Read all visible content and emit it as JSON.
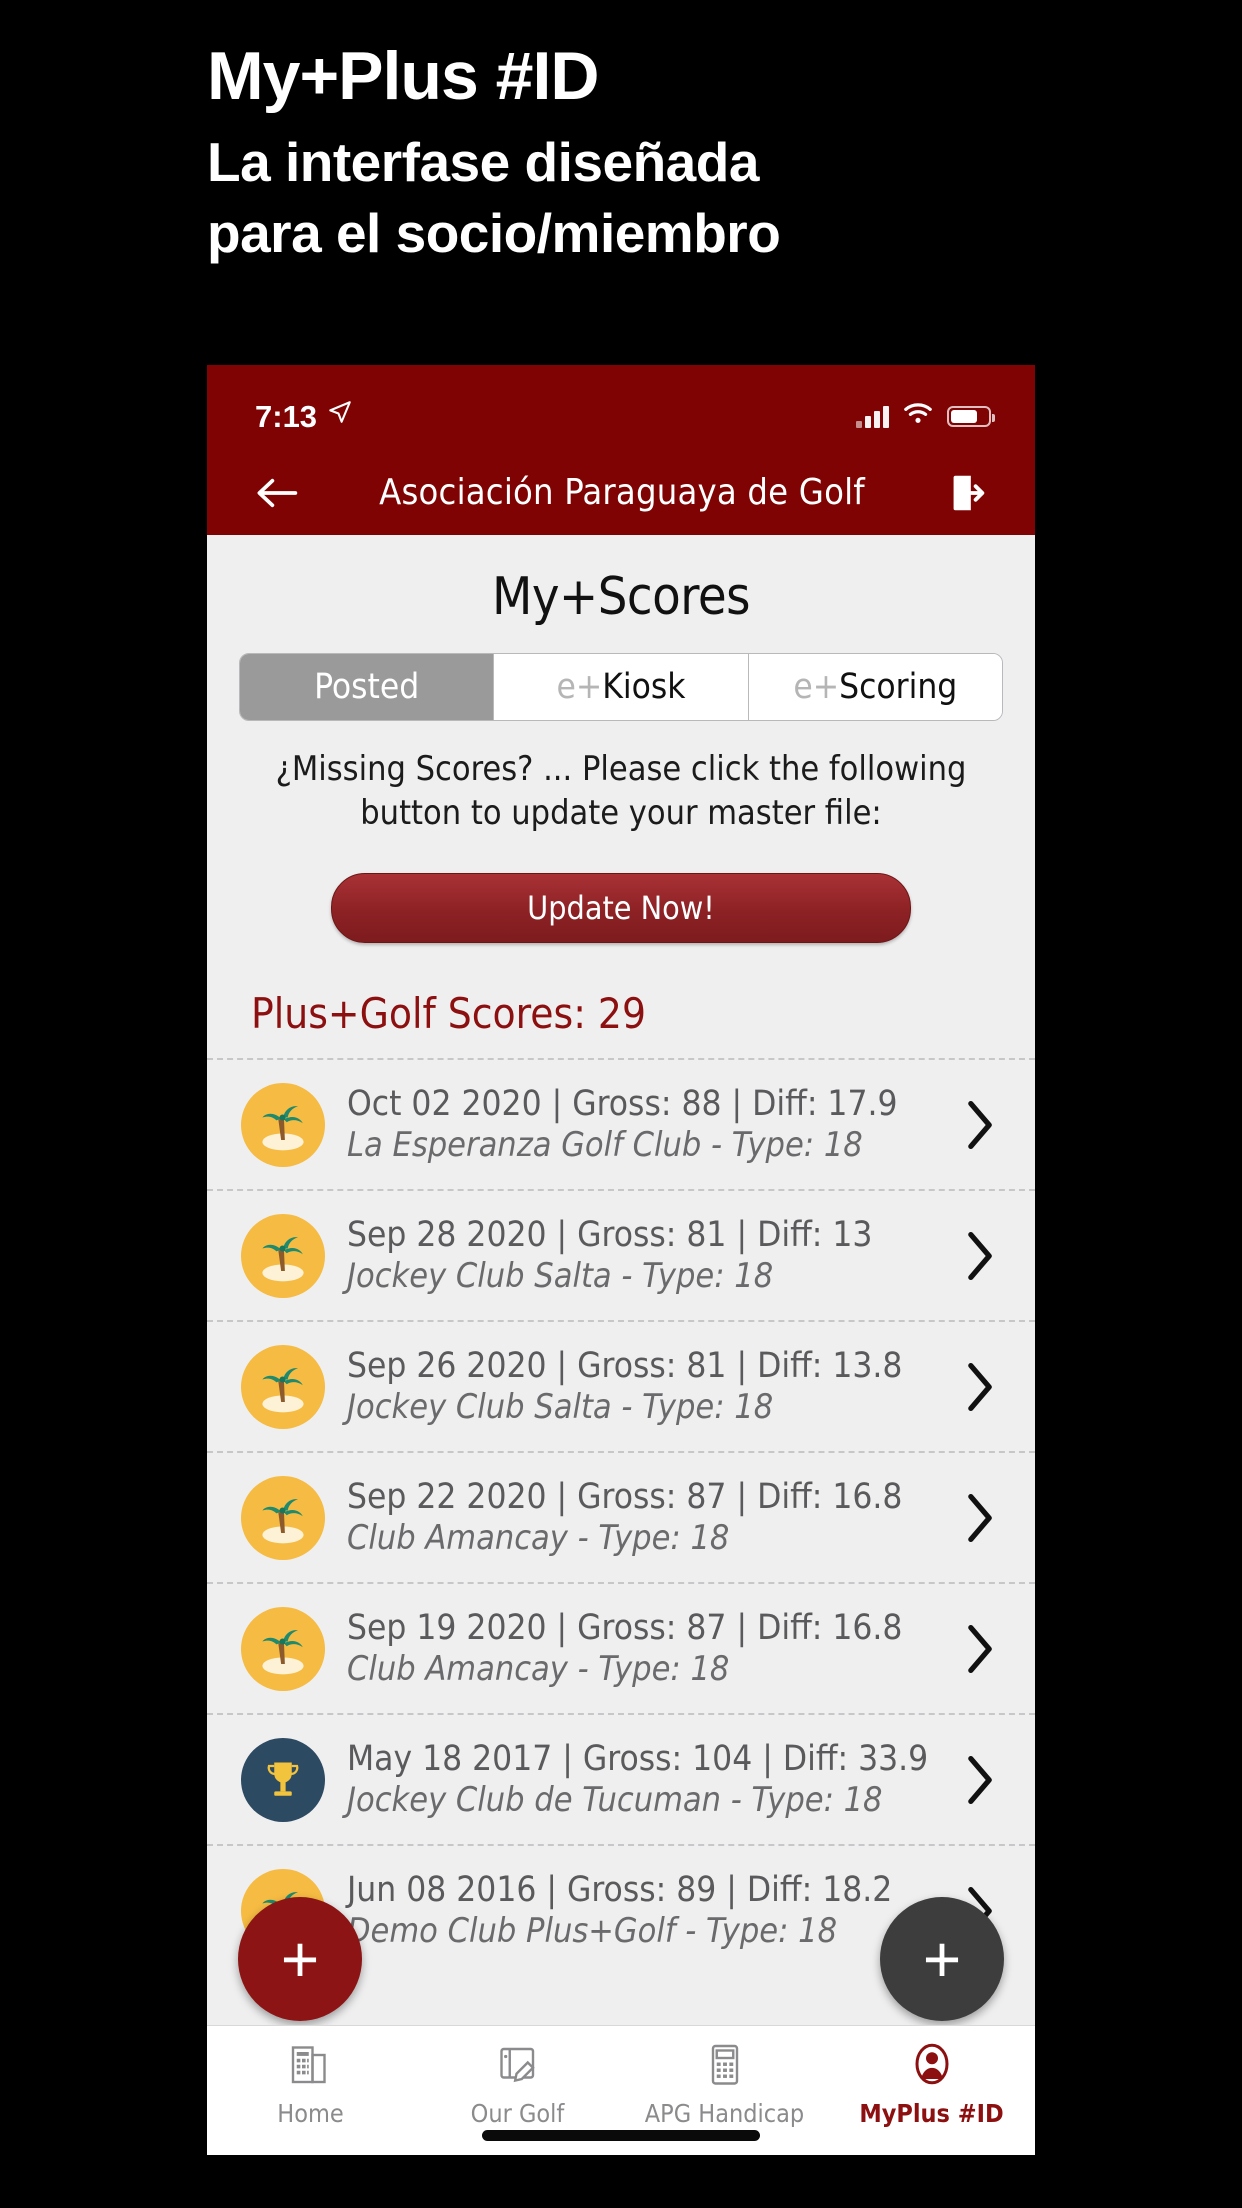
{
  "promo": {
    "title": "My+Plus #ID",
    "subtitle_line1": "La interfase diseñada",
    "subtitle_line2": "para el socio/miembro"
  },
  "colors": {
    "brand_red": "#800303",
    "accent_red": "#8d1010",
    "button_red": "#8e2225",
    "screen_bg": "#efeff0",
    "segment_active": "#9a9a9a",
    "palm_badge": "#f5bb42",
    "trophy_badge": "#2d4a63",
    "fab_left": "#8c1414",
    "fab_right": "#3d3d3d"
  },
  "statusbar": {
    "time": "7:13",
    "location_icon": "location-arrow-icon",
    "signal_icon": "cellular-signal-icon",
    "wifi_icon": "wifi-icon",
    "battery_icon": "battery-icon"
  },
  "navbar": {
    "back_icon": "back-arrow-icon",
    "title": "Asociación Paraguaya de Golf",
    "logout_icon": "logout-icon"
  },
  "screen": {
    "title": "My+Scores"
  },
  "segments": [
    {
      "prefix": "",
      "label": "Posted",
      "active": true
    },
    {
      "prefix": "e+",
      "label": "Kiosk",
      "active": false
    },
    {
      "prefix": "e+",
      "label": "Scoring",
      "active": false
    }
  ],
  "notice": {
    "text": "¿Missing Scores? ... Please click the following button to update your master file:"
  },
  "update_button": {
    "label": "Update Now!"
  },
  "scores_header": {
    "label": "Plus+Golf Scores: 29"
  },
  "scores": [
    {
      "icon": "palm-tree-icon",
      "icon_type": "palm",
      "line1": "Oct 02 2020 | Gross: 88 | Diff: 17.9",
      "line2": "La Esperanza Golf Club - Type: 18",
      "date": "Oct 02 2020",
      "gross": 88,
      "diff": 17.9,
      "club": "La Esperanza Golf Club",
      "type": 18
    },
    {
      "icon": "palm-tree-icon",
      "icon_type": "palm",
      "line1": "Sep 28 2020 | Gross: 81 | Diff: 13",
      "line2": "Jockey Club Salta - Type: 18",
      "date": "Sep 28 2020",
      "gross": 81,
      "diff": 13,
      "club": "Jockey Club Salta",
      "type": 18
    },
    {
      "icon": "palm-tree-icon",
      "icon_type": "palm",
      "line1": "Sep 26 2020 | Gross: 81 | Diff: 13.8",
      "line2": "Jockey Club Salta - Type: 18",
      "date": "Sep 26 2020",
      "gross": 81,
      "diff": 13.8,
      "club": "Jockey Club Salta",
      "type": 18
    },
    {
      "icon": "palm-tree-icon",
      "icon_type": "palm",
      "line1": "Sep 22 2020 | Gross: 87 | Diff: 16.8",
      "line2": "Club Amancay - Type: 18",
      "date": "Sep 22 2020",
      "gross": 87,
      "diff": 16.8,
      "club": "Club Amancay",
      "type": 18
    },
    {
      "icon": "palm-tree-icon",
      "icon_type": "palm",
      "line1": "Sep 19 2020 | Gross: 87 | Diff: 16.8",
      "line2": "Club Amancay - Type: 18",
      "date": "Sep 19 2020",
      "gross": 87,
      "diff": 16.8,
      "club": "Club Amancay",
      "type": 18
    },
    {
      "icon": "trophy-icon",
      "icon_type": "trophy",
      "line1": "May 18 2017 | Gross: 104 | Diff: 33.9",
      "line2": "Jockey Club de Tucuman - Type: 18",
      "date": "May 18 2017",
      "gross": 104,
      "diff": 33.9,
      "club": "Jockey Club de Tucuman",
      "type": 18
    },
    {
      "icon": "palm-tree-icon",
      "icon_type": "palm",
      "line1": "Jun 08 2016 | Gross: 89 | Diff: 18.2",
      "line2": "Demo Club Plus+Golf - Type: 18",
      "date": "Jun 08 2016",
      "gross": 89,
      "diff": 18.2,
      "club": "Demo Club Plus+Golf",
      "type": 18
    }
  ],
  "fabs": {
    "left": {
      "label": "+",
      "name": "add-score-button"
    },
    "right": {
      "label": "+",
      "name": "add-button"
    }
  },
  "tabs": [
    {
      "label": "Home",
      "icon": "building-icon",
      "active": false
    },
    {
      "label": "Our Golf",
      "icon": "tablet-pen-icon",
      "active": false
    },
    {
      "label": "APG Handicap",
      "icon": "calculator-icon",
      "active": false
    },
    {
      "label": "MyPlus #ID",
      "icon": "person-badge-icon",
      "active": true
    }
  ]
}
